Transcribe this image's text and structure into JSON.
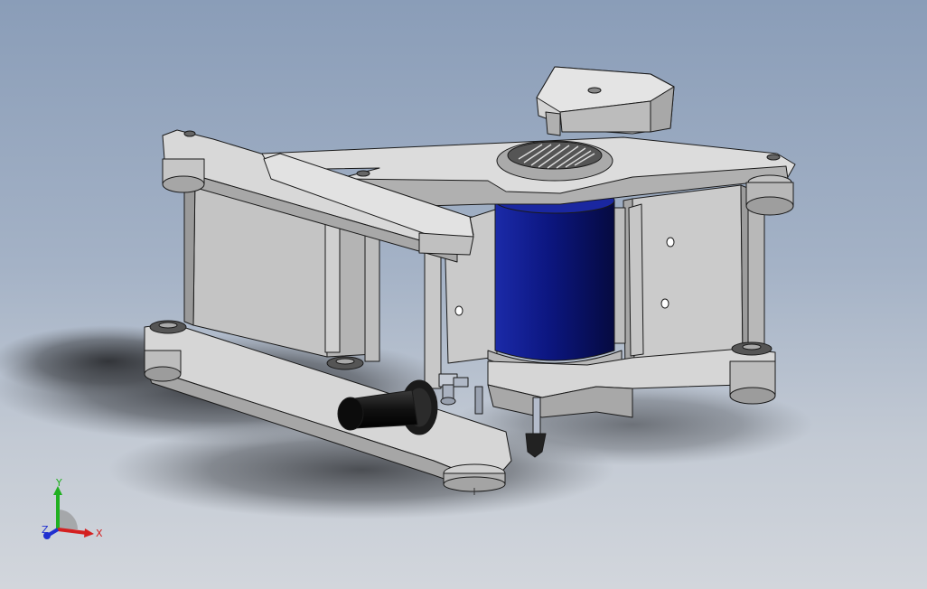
{
  "viewport": {
    "background_top": "#8a9db8",
    "background_bottom": "#d2d6dc"
  },
  "model": {
    "body_color": "#c8c8c8",
    "edge_color": "#1a1a1a",
    "coil_color": "#101c8c",
    "shadow_color": "#3a3c40"
  },
  "triad": {
    "x_label": "X",
    "y_label": "Y",
    "z_label": "Z",
    "x_color": "#d42020",
    "y_color": "#20b020",
    "z_color": "#2030d0"
  }
}
